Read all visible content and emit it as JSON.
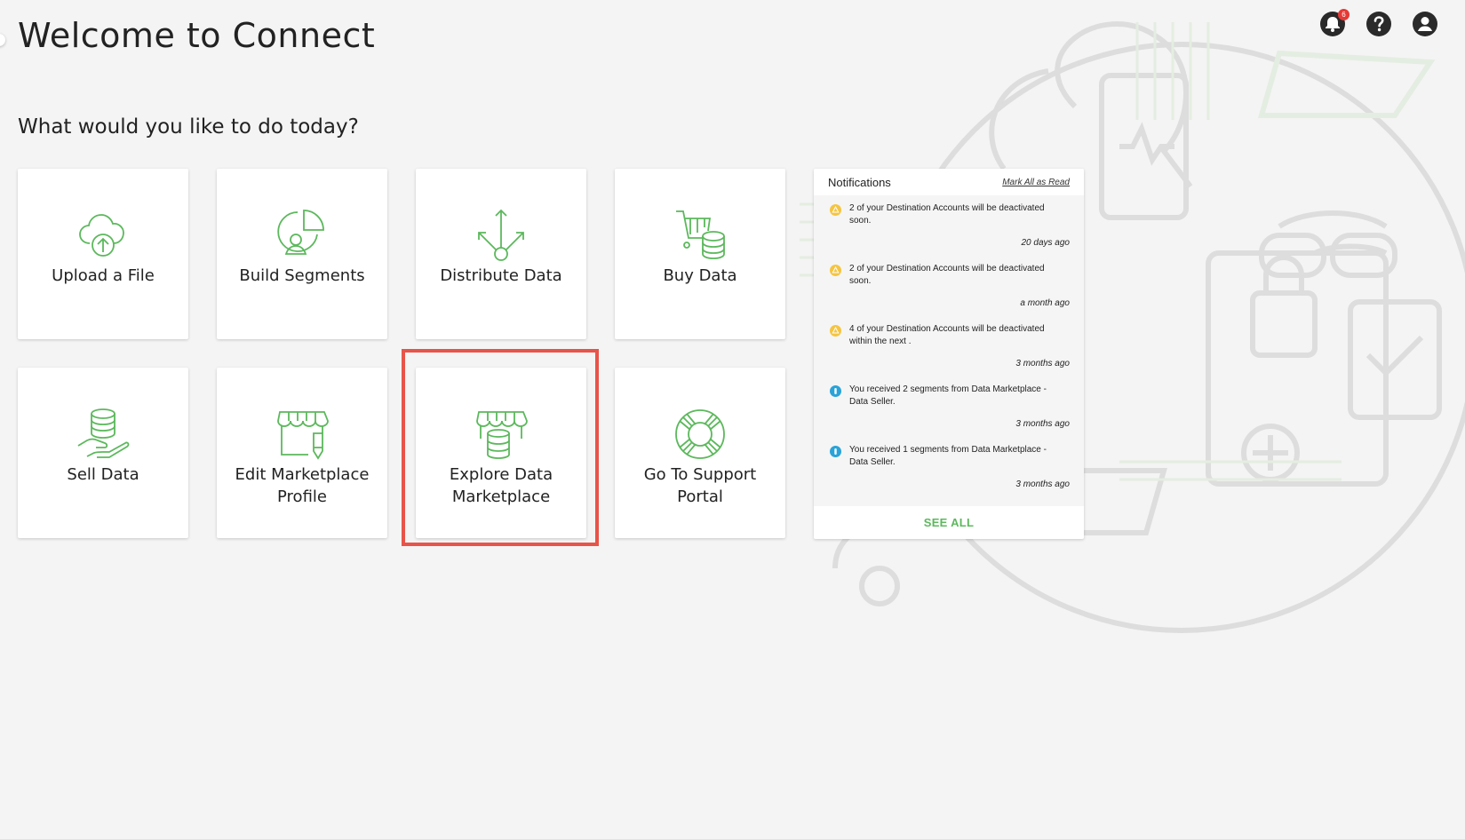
{
  "header": {
    "welcome_title": "Welcome to Connect",
    "subtitle": "What would you like to do today?",
    "notification_count": "6"
  },
  "tiles": [
    {
      "label": "Upload a File",
      "icon": "cloud-upload-icon"
    },
    {
      "label": "Build Segments",
      "icon": "segment-pie-icon"
    },
    {
      "label": "Distribute Data",
      "icon": "distribute-arrows-icon"
    },
    {
      "label": "Buy Data",
      "icon": "cart-database-icon"
    },
    {
      "label": "Sell Data",
      "icon": "hand-database-icon"
    },
    {
      "label": "Edit Marketplace Profile",
      "icon": "storefront-edit-icon"
    },
    {
      "label": "Explore Data Marketplace",
      "icon": "storefront-database-icon"
    },
    {
      "label": "Go To Support Portal",
      "icon": "lifebuoy-icon"
    }
  ],
  "notifications": {
    "title": "Notifications",
    "mark_all_label": "Mark All as Read",
    "see_all_label": "SEE ALL",
    "items": [
      {
        "type": "warning",
        "text": "2 of your Destination Accounts will be deactivated soon.",
        "time": "20 days ago"
      },
      {
        "type": "warning",
        "text": "2 of your Destination Accounts will be deactivated soon.",
        "time": "a month ago"
      },
      {
        "type": "warning",
        "text": "4 of your Destination Accounts will be deactivated within the next .",
        "time": "3 months ago"
      },
      {
        "type": "info",
        "text": "You received 2 segments from Data Marketplace - Data Seller.",
        "time": "3 months ago"
      },
      {
        "type": "info",
        "text": "You received 1 segments from Data Marketplace - Data Seller.",
        "time": "3 months ago"
      }
    ]
  },
  "colors": {
    "accent_green": "#5cb85c",
    "highlight_red": "#e8544a",
    "warning_yellow": "#f5c542",
    "info_blue": "#2aa3d8",
    "badge_red": "#e53935"
  }
}
